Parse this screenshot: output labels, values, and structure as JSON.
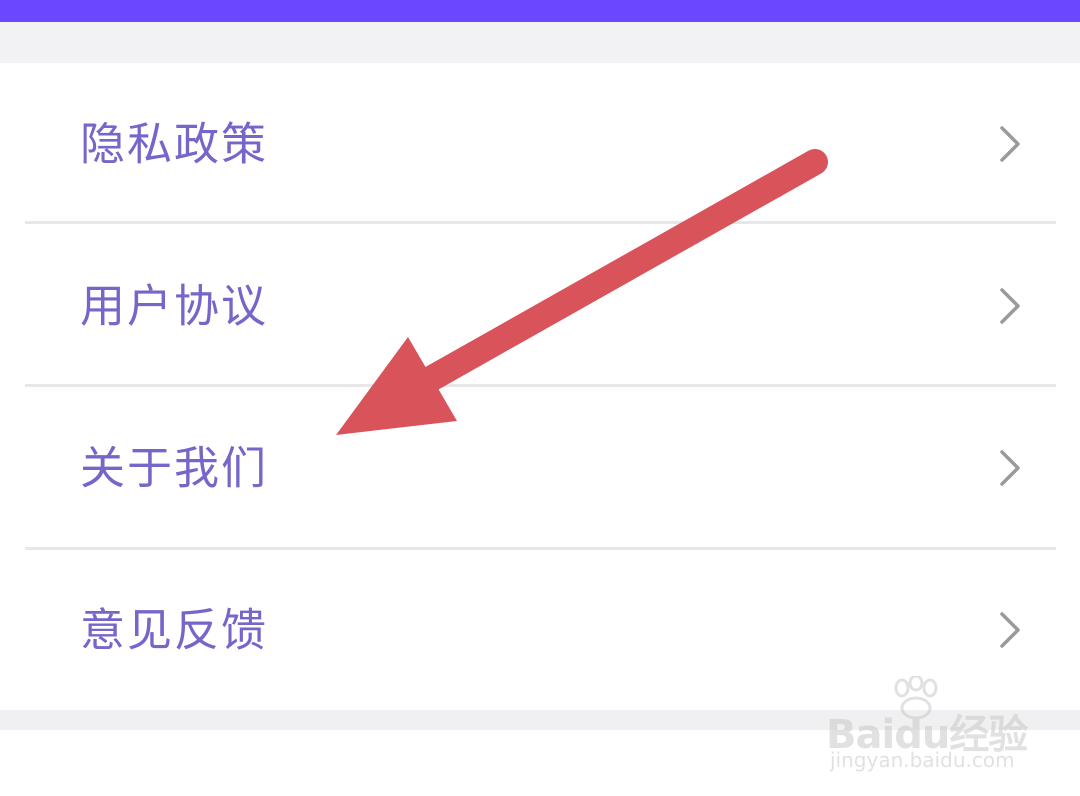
{
  "colors": {
    "header_bar": "#6b47ff",
    "label_text": "#7566c9",
    "chevron": "#9a9a9a",
    "arrow": "#d9535a"
  },
  "menu": {
    "items": [
      {
        "label": "隐私政策",
        "icon": "chevron-right-icon"
      },
      {
        "label": "用户协议",
        "icon": "chevron-right-icon"
      },
      {
        "label": "关于我们",
        "icon": "chevron-right-icon"
      },
      {
        "label": "意见反馈",
        "icon": "chevron-right-icon"
      }
    ]
  },
  "annotation": {
    "icon": "red-arrow-pointer",
    "points_to": "关于我们"
  },
  "watermark": {
    "brand": "Baidu经验",
    "site": "jingyan.baidu.com",
    "icon": "baidu-paw-icon"
  }
}
